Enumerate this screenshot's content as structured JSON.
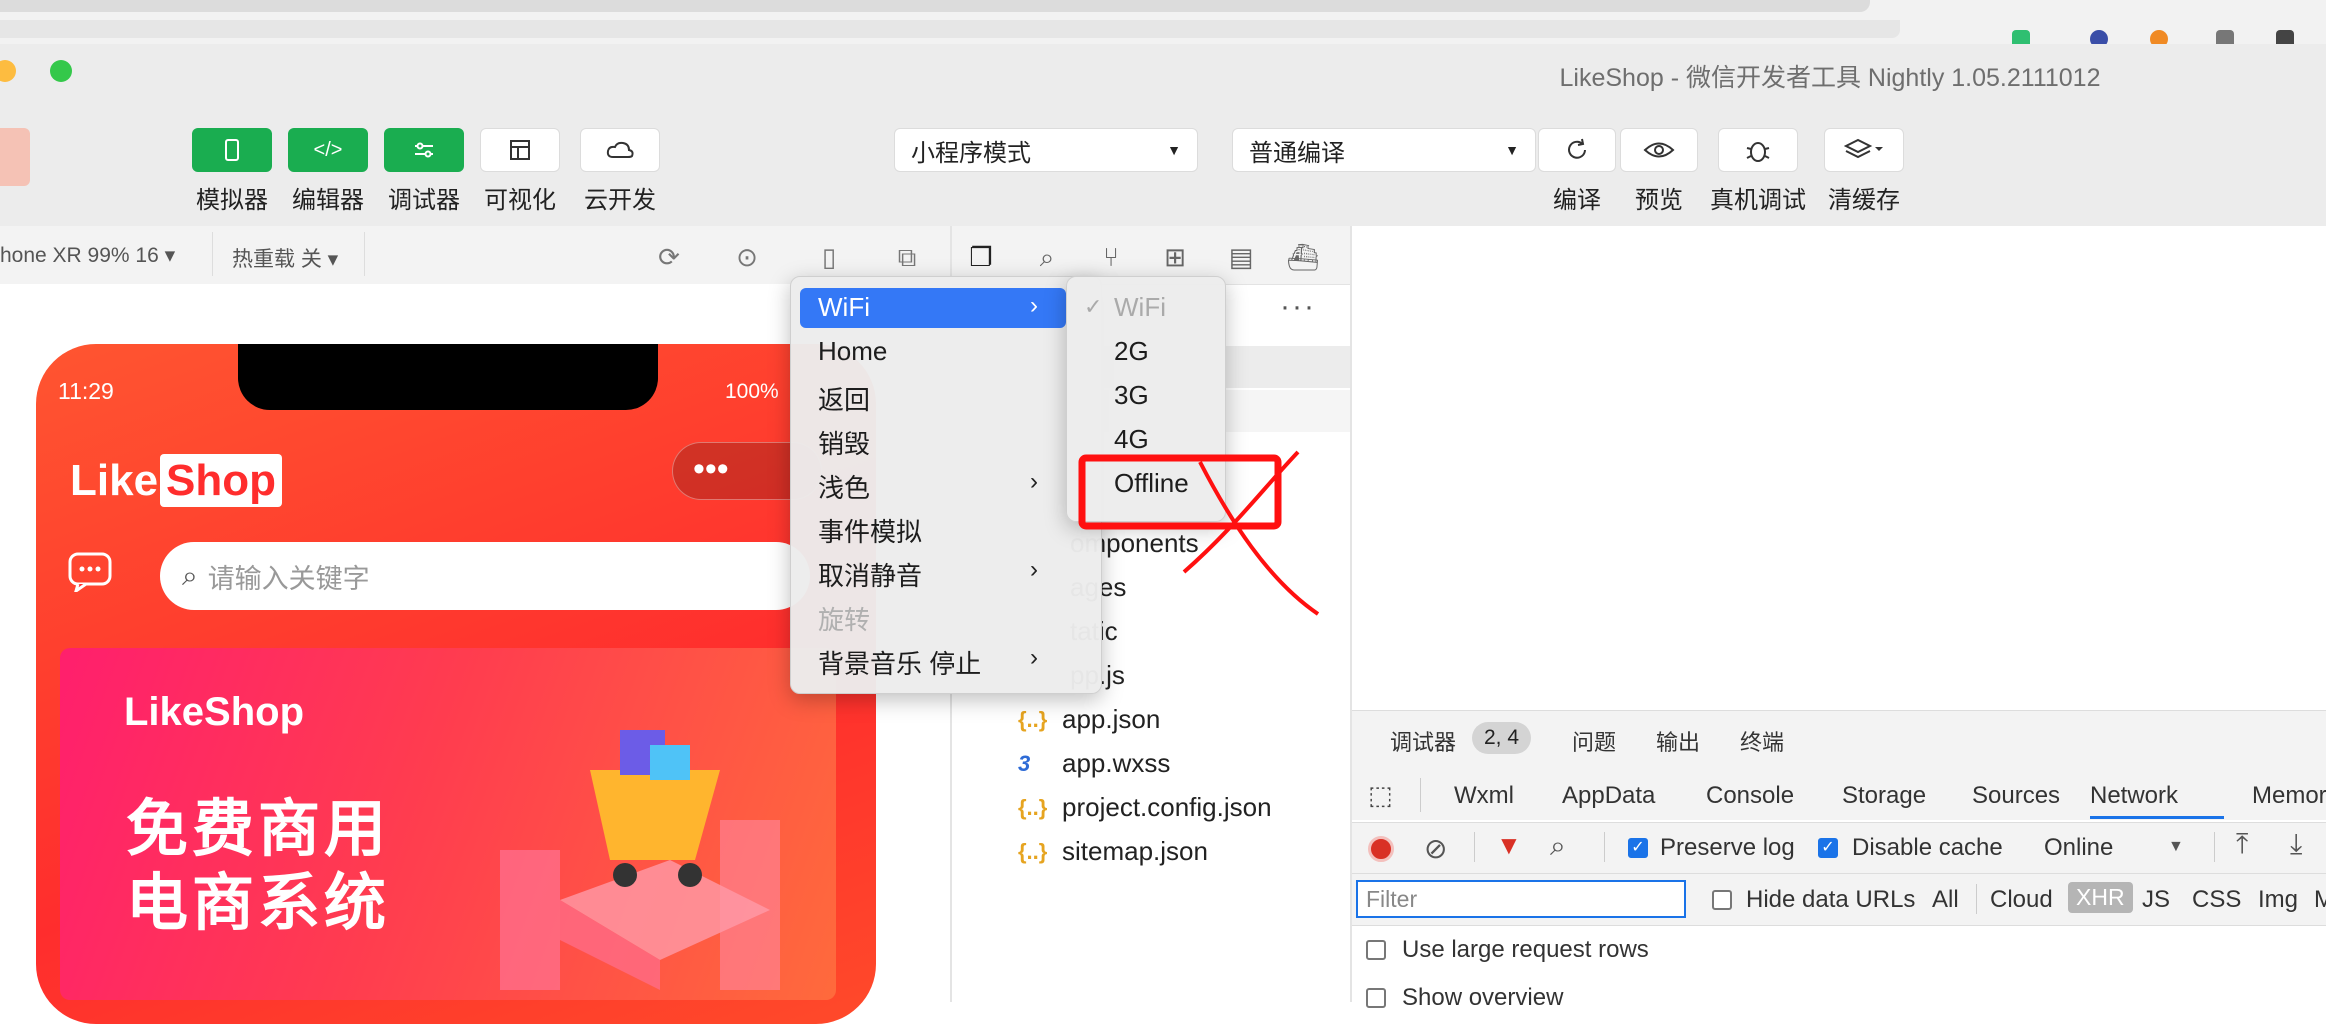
{
  "window": {
    "title": "LikeShop - 微信开发者工具 Nightly 1.05.2111012"
  },
  "toolbar": {
    "left_buttons": [
      {
        "label": "模拟器",
        "icon": "phone-icon"
      },
      {
        "label": "编辑器",
        "icon": "code-icon"
      },
      {
        "label": "调试器",
        "icon": "sliders-icon"
      },
      {
        "label": "可视化",
        "icon": "layout-icon"
      },
      {
        "label": "云开发",
        "icon": "cloud-icon"
      }
    ],
    "mode_select": "小程序模式",
    "compile_select": "普通编译",
    "right_buttons": [
      {
        "label": "编译",
        "icon": "refresh-icon"
      },
      {
        "label": "预览",
        "icon": "eye-icon"
      },
      {
        "label": "真机调试",
        "icon": "bug-icon"
      },
      {
        "label": "清缓存",
        "icon": "layers-icon"
      }
    ]
  },
  "simulator": {
    "device": "hone XR 99% 16 ▾",
    "hot_reload": "热重载 关 ▾",
    "phone": {
      "time": "11:29",
      "battery": "100%",
      "logo_a": "Like",
      "logo_b": "Shop",
      "capsule": "•••",
      "search_placeholder": "请输入关键字",
      "banner_brand": "LikeShop",
      "banner_line1": "免费商用",
      "banner_line2": "电商系统"
    }
  },
  "file_tree": {
    "more": "···",
    "items": [
      {
        "name": "omponents",
        "icon": "folder-icon"
      },
      {
        "name": "ages",
        "icon": "folder-icon"
      },
      {
        "name": "tatic",
        "icon": "folder-icon"
      },
      {
        "name": "pp.js",
        "icon": "js-file-icon"
      },
      {
        "name": "app.json",
        "icon": "json-file-icon",
        "glyph": "{..}"
      },
      {
        "name": "app.wxss",
        "icon": "css-file-icon",
        "glyph": "3"
      },
      {
        "name": "project.config.json",
        "icon": "json-file-icon",
        "glyph": "{..}"
      },
      {
        "name": "sitemap.json",
        "icon": "json-file-icon",
        "glyph": "{..}"
      }
    ]
  },
  "context_menu": {
    "items": [
      "WiFi",
      "Home",
      "返回",
      "销毁",
      "浅色",
      "事件模拟",
      "取消静音",
      "旋转",
      "背景音乐 停止"
    ],
    "submenu": [
      "WiFi",
      "2G",
      "3G",
      "4G",
      "Offline"
    ],
    "check": "✓"
  },
  "devtools": {
    "tabs": [
      "调试器",
      "问题",
      "输出",
      "终端"
    ],
    "badge": "2, 4",
    "panels": [
      "Wxml",
      "AppData",
      "Console",
      "Storage",
      "Sources",
      "Network",
      "Memor"
    ],
    "preserve_log": "Preserve log",
    "disable_cache": "Disable cache",
    "throttle": "Online",
    "filter_placeholder": "Filter",
    "hide_data_urls": "Hide data URLs",
    "types": [
      "All",
      "Cloud",
      "XHR",
      "JS",
      "CSS",
      "Img",
      "M"
    ],
    "large_rows": "Use large request rows",
    "show_overview": "Show overview"
  },
  "colors": {
    "accent_green": "#1aad50",
    "menu_highlight": "#3478f6",
    "annotation_red": "#ff0000"
  }
}
